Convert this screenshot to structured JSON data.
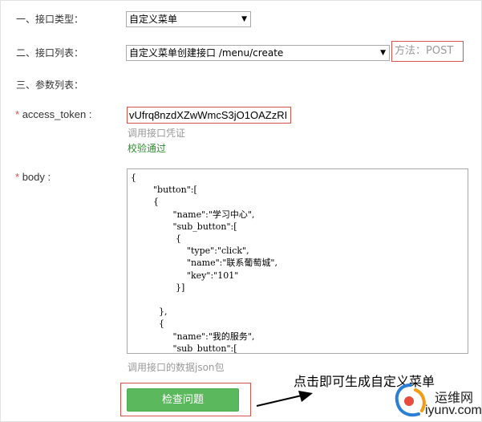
{
  "form": {
    "row1_label": "一、接口类型：",
    "row1_select": "自定义菜单",
    "row2_label": "二、接口列表：",
    "row2_select": "自定义菜单创建接口 /menu/create",
    "method": "方法：POST",
    "row3_label": "三、参数列表："
  },
  "fields": {
    "token": {
      "star": "*",
      "label": "access_token :",
      "value": "vUfrq8nzdXZwWmcS3jO1OAZzRI",
      "hint": "调用接口凭证",
      "status": "校验通过"
    },
    "body": {
      "star": "*",
      "label": "body :",
      "value": "{\n        \"button\":[\n        {\n               \"name\":\"学习中心\",\n               \"sub_button\":[\n                {\n                    \"type\":\"click\",\n                    \"name\":\"联系葡萄城\",\n                    \"key\":\"101\"\n                }]\n\n          },\n          {\n               \"name\":\"我的服务\",\n               \"sub_button\":[",
      "hint": "调用接口的数据json包"
    }
  },
  "actions": {
    "submit_label": "检查问题"
  },
  "annotation": {
    "text": "点击即可生成自定义菜单"
  },
  "watermark": {
    "cn": "运维网",
    "en": "iyunv.com"
  },
  "colors": {
    "highlight": "#d9534f",
    "button_green": "#5cb85c",
    "success_text": "#2e8b2e"
  }
}
